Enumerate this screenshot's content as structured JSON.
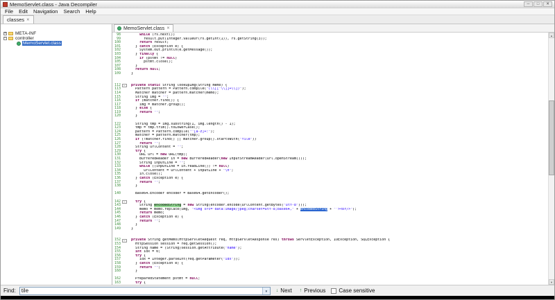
{
  "window": {
    "title": "MemoServlet.class - Java Decompiler",
    "minimize_glyph": "─",
    "maximize_glyph": "□",
    "close_glyph": "✕"
  },
  "menubar": {
    "items": [
      "File",
      "Edit",
      "Navigation",
      "Search",
      "Help"
    ]
  },
  "tabbar": {
    "active_tab": "classes",
    "close_glyph": "✕"
  },
  "tree": {
    "items": [
      {
        "label": "META-INF",
        "icon": "folder",
        "expander": "plus",
        "level": 0,
        "selected": false
      },
      {
        "label": "controller",
        "icon": "folder",
        "expander": "minus",
        "level": 0,
        "selected": false
      },
      {
        "label": "MemoServlet.class",
        "icon": "class",
        "expander": "none",
        "level": 1,
        "selected": true
      }
    ]
  },
  "editor": {
    "tab_label": "MemoServlet.class",
    "tab_close_glyph": "✕",
    "lines": [
      {
        "n": 98,
        "text": "      while (rs.next())"
      },
      {
        "n": 99,
        "text": "        result.put(Integer.valueOf(rs.getInt(1)), rs.getString(3));"
      },
      {
        "n": 100,
        "text": "      return result;"
      },
      {
        "n": 101,
        "text": "    } catch (Exception e) {"
      },
      {
        "n": 102,
        "text": "      System.out.println(e.getMessage());"
      },
      {
        "n": 103,
        "text": "    } finally {"
      },
      {
        "n": 104,
        "text": "      if (pstmt != null)"
      },
      {
        "n": 105,
        "text": "        pstmt.close();"
      },
      {
        "n": 107,
        "text": "    }"
      },
      {
        "n": 108,
        "text": "    return null;"
      },
      {
        "n": 109,
        "text": "  }"
      },
      {
        "n": null,
        "text": ""
      },
      {
        "n": null,
        "text": ""
      },
      {
        "n": 112,
        "text": "  private static String lookupImg(String memo) {",
        "fold": true
      },
      {
        "n": 113,
        "text": "    Pattern pattern = Pattern.compile(\"(\\\\[[^\\\\]]+\\\\])\");"
      },
      {
        "n": 114,
        "text": "    Matcher matcher = pattern.matcher(memo);"
      },
      {
        "n": 115,
        "text": "    String img = \"\";"
      },
      {
        "n": 116,
        "text": "    if (matcher.find()) {"
      },
      {
        "n": 117,
        "text": "      img = matcher.group();"
      },
      {
        "n": 118,
        "text": "    } else {"
      },
      {
        "n": 119,
        "text": "      return \"\";"
      },
      {
        "n": 120,
        "text": "    }"
      },
      {
        "n": null,
        "text": ""
      },
      {
        "n": 122,
        "text": "    String tmp = img.substring(1, img.length() - 1);"
      },
      {
        "n": 123,
        "text": "    tmp = tmp.trim().toLowerCase();"
      },
      {
        "n": 124,
        "text": "    pattern = Pattern.compile(\"^[a-z]+:\");"
      },
      {
        "n": 125,
        "text": "    matcher = pattern.matcher(tmp);"
      },
      {
        "n": 126,
        "text": "    if (!matcher.find() || matcher.group().startsWith(\"file\"))"
      },
      {
        "n": 127,
        "text": "      return \"\";"
      },
      {
        "n": 128,
        "text": "    String urlContent = \"\";"
      },
      {
        "n": 129,
        "text": "    try {"
      },
      {
        "n": 130,
        "text": "      URL url = new URL(tmp);"
      },
      {
        "n": 131,
        "text": "      BufferedReader in = new BufferedReader(new InputStreamReader(url.openStream()));"
      },
      {
        "n": 132,
        "text": "      String inputLine = \"\";"
      },
      {
        "n": 133,
        "text": "      while ((inputLine = in.readLine()) != null)"
      },
      {
        "n": 134,
        "text": "        urlContent = urlContent + inputLine + \"\\n\";"
      },
      {
        "n": 135,
        "text": "      in.close();"
      },
      {
        "n": 136,
        "text": "    } catch (Exception e) {"
      },
      {
        "n": 137,
        "text": "      return \"\";"
      },
      {
        "n": 138,
        "text": "    }"
      },
      {
        "n": null,
        "text": ""
      },
      {
        "n": 140,
        "text": "    Base64.Encoder encoder = Base64.getEncoder();"
      },
      {
        "n": null,
        "text": ""
      },
      {
        "n": 142,
        "text": "    try {",
        "fold": true
      },
      {
        "n": 143,
        "text": "      String encodedString = new String(encoder.encode(urlContent.getBytes(\"utf-8\")));",
        "mark": {
          "word": "encodedString",
          "kind": "occurrence"
        }
      },
      {
        "n": 144,
        "text": "      memo = memo.replace(img, \"<img src='data:image/jpeg;charset=utf-8;base64,\" + encodedString + \"'><br/>\");",
        "mark": {
          "word": "encodedString",
          "kind": "selection"
        }
      },
      {
        "n": 145,
        "text": "      return memo;"
      },
      {
        "n": 146,
        "text": "    } catch (Exception e) {"
      },
      {
        "n": 147,
        "text": "      return \"\";"
      },
      {
        "n": 148,
        "text": "    }"
      },
      {
        "n": 149,
        "text": "  }"
      },
      {
        "n": null,
        "text": ""
      },
      {
        "n": null,
        "text": ""
      },
      {
        "n": 152,
        "text": "  private String getMemo(HttpServletRequest req, HttpServletResponse res) throws ServletException, IOException, SQLException {",
        "fold": true
      },
      {
        "n": 153,
        "text": "    HttpSession session = req.getSession();"
      },
      {
        "n": 154,
        "text": "    String name = (String)session.getAttribute(\"name\");"
      },
      {
        "n": 155,
        "text": "    int idx = 0;"
      },
      {
        "n": 156,
        "text": "    try {"
      },
      {
        "n": 157,
        "text": "      idx = Integer.parseInt(req.getParameter(\"idx\"));"
      },
      {
        "n": 158,
        "text": "    } catch (Exception e) {"
      },
      {
        "n": 159,
        "text": "      return \"\";"
      },
      {
        "n": 160,
        "text": "    }"
      },
      {
        "n": null,
        "text": ""
      },
      {
        "n": 162,
        "text": "    PreparedStatement pstmt = null;"
      },
      {
        "n": 163,
        "text": "    try {"
      }
    ]
  },
  "find_bar": {
    "label": "Find:",
    "value": "tile",
    "next_label": "Next",
    "previous_label": "Previous",
    "case_label": "Case sensitive",
    "case_checked": false,
    "next_icon_glyph": "↓",
    "previous_icon_glyph": "↑",
    "dropdown_glyph": "▼"
  },
  "colors": {
    "keyword": "#7f0055",
    "string": "#2a00ff",
    "line_number": "#3f8f3f",
    "selection_bg": "#2a65d0",
    "occurrence_bg": "#96dc96",
    "tree_selection_bg": "#316ac5"
  }
}
